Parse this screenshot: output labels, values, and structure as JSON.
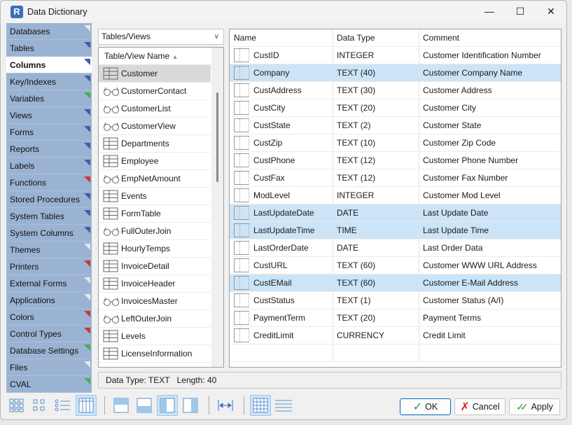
{
  "window": {
    "title": "Data Dictionary",
    "controls": [
      "minimize",
      "maximize",
      "close"
    ]
  },
  "sidebar": {
    "items": [
      {
        "label": "Databases",
        "marker": "#e8e8e8"
      },
      {
        "label": "Tables",
        "marker": "#3a5fa8"
      },
      {
        "label": "Columns",
        "marker": "#3a5fa8",
        "active": true
      },
      {
        "label": "Key/Indexes",
        "marker": "#3a5fa8"
      },
      {
        "label": "Variables",
        "marker": "#4caa4c"
      },
      {
        "label": "Views",
        "marker": "#3a5fa8"
      },
      {
        "label": "Forms",
        "marker": "#3a5fa8"
      },
      {
        "label": "Reports",
        "marker": "#3a5fa8"
      },
      {
        "label": "Labels",
        "marker": "#3a5fa8"
      },
      {
        "label": "Functions",
        "marker": "#cc3333"
      },
      {
        "label": "Stored Procedures",
        "marker": "#3a5fa8"
      },
      {
        "label": "System Tables",
        "marker": "#3a5fa8"
      },
      {
        "label": "System Columns",
        "marker": "#3a5fa8"
      },
      {
        "label": "Themes",
        "marker": "#e8e8e8"
      },
      {
        "label": "Printers",
        "marker": "#cc3333"
      },
      {
        "label": "External Forms",
        "marker": "#e8e8e8"
      },
      {
        "label": "Applications",
        "marker": "#e8e8e8"
      },
      {
        "label": "Colors",
        "marker": "#cc3333"
      },
      {
        "label": "Control Types",
        "marker": "#cc3333"
      },
      {
        "label": "Database Settings",
        "marker": "#4caa4c"
      },
      {
        "label": "Files",
        "marker": "#e8e8e8"
      },
      {
        "label": "CVAL",
        "marker": "#4caa4c"
      }
    ]
  },
  "tables": {
    "filter": "Tables/Views",
    "header": "Table/View Name",
    "sort_icon": "sort-ascending",
    "items": [
      {
        "name": "Customer",
        "kind": "table",
        "selected": true
      },
      {
        "name": "CustomerContact",
        "kind": "view"
      },
      {
        "name": "CustomerList",
        "kind": "view"
      },
      {
        "name": "CustomerView",
        "kind": "view"
      },
      {
        "name": "Departments",
        "kind": "table"
      },
      {
        "name": "Employee",
        "kind": "table"
      },
      {
        "name": "EmpNetAmount",
        "kind": "view"
      },
      {
        "name": "Events",
        "kind": "table"
      },
      {
        "name": "FormTable",
        "kind": "table"
      },
      {
        "name": "FullOuterJoin",
        "kind": "view"
      },
      {
        "name": "HourlyTemps",
        "kind": "table"
      },
      {
        "name": "InvoiceDetail",
        "kind": "table"
      },
      {
        "name": "InvoiceHeader",
        "kind": "table"
      },
      {
        "name": "InvoicesMaster",
        "kind": "view"
      },
      {
        "name": "LeftOuterJoin",
        "kind": "view"
      },
      {
        "name": "Levels",
        "kind": "table"
      },
      {
        "name": "LicenseInformation",
        "kind": "table"
      }
    ]
  },
  "columns": {
    "headers": [
      "Name",
      "Data Type",
      "Comment"
    ],
    "rows": [
      {
        "name": "CustID",
        "type": "INTEGER",
        "comment": "Customer Identification Number"
      },
      {
        "name": "Company",
        "type": "TEXT (40)",
        "comment": "Customer Company Name",
        "hl": true
      },
      {
        "name": "CustAddress",
        "type": "TEXT (30)",
        "comment": "Customer Address"
      },
      {
        "name": "CustCity",
        "type": "TEXT (20)",
        "comment": "Customer City"
      },
      {
        "name": "CustState",
        "type": "TEXT (2)",
        "comment": "Customer State"
      },
      {
        "name": "CustZip",
        "type": "TEXT (10)",
        "comment": "Customer Zip Code"
      },
      {
        "name": "CustPhone",
        "type": "TEXT (12)",
        "comment": "Customer Phone Number"
      },
      {
        "name": "CustFax",
        "type": "TEXT (12)",
        "comment": "Customer Fax Number"
      },
      {
        "name": "ModLevel",
        "type": "INTEGER",
        "comment": "Customer Mod Level"
      },
      {
        "name": "LastUpdateDate",
        "type": "DATE",
        "comment": "Last Update Date",
        "hl": true
      },
      {
        "name": "LastUpdateTime",
        "type": "TIME",
        "comment": "Last Update Time",
        "hl": true
      },
      {
        "name": "LastOrderDate",
        "type": "DATE",
        "comment": "Last Order Data"
      },
      {
        "name": "CustURL",
        "type": "TEXT (60)",
        "comment": "Customer WWW URL Address"
      },
      {
        "name": "CustEMail",
        "type": "TEXT (60)",
        "comment": "Customer E-Mail Address",
        "hl": true
      },
      {
        "name": "CustStatus",
        "type": "TEXT (1)",
        "comment": "Customer Status (A/I)"
      },
      {
        "name": "PaymentTerm",
        "type": "TEXT (20)",
        "comment": "Payment Terms"
      },
      {
        "name": "CreditLimit",
        "type": "CURRENCY",
        "comment": "Credit Limit"
      }
    ]
  },
  "status": {
    "data_type": "Data Type: TEXT",
    "length": "Length: 40"
  },
  "buttons": {
    "ok": "OK",
    "cancel": "Cancel",
    "apply": "Apply"
  }
}
